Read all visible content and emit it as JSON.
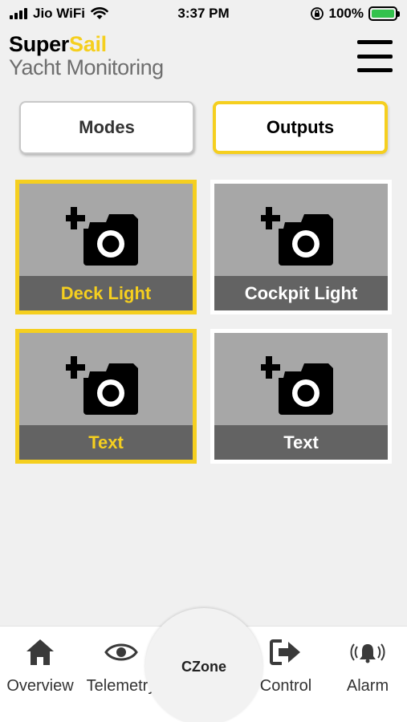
{
  "status_bar": {
    "carrier": "Jio WiFi",
    "time": "3:37 PM",
    "battery_percent": "100%",
    "icons": [
      "signal-icon",
      "wifi-icon",
      "orientation-lock-icon",
      "battery-charging-icon"
    ]
  },
  "header": {
    "brand_prefix": "Super",
    "brand_accent": "Sail",
    "subtitle": "Yacht Monitoring",
    "menu_icon": "hamburger-menu-icon"
  },
  "segment": {
    "modes_label": "Modes",
    "outputs_label": "Outputs",
    "selected": "Outputs"
  },
  "tiles": [
    {
      "label": "Deck Light",
      "icon": "add-photo-icon",
      "active": true
    },
    {
      "label": "Cockpit Light",
      "icon": "add-photo-icon",
      "active": false
    },
    {
      "label": "Text",
      "icon": "add-photo-icon",
      "active": true
    },
    {
      "label": "Text",
      "icon": "add-photo-icon",
      "active": false
    }
  ],
  "nav": {
    "items": [
      {
        "label": "Overview",
        "icon": "home-icon"
      },
      {
        "label": "Telemetry",
        "icon": "eye-icon"
      },
      {
        "label": "CZone",
        "icon": ""
      },
      {
        "label": "Control",
        "icon": "exit-arrow-icon"
      },
      {
        "label": "Alarm",
        "icon": "alarm-bell-icon"
      }
    ]
  },
  "colors": {
    "accent": "#f5cf1f",
    "tile_bg": "#a7a7a7",
    "tile_label_bg": "#636363",
    "page_bg": "#f0f0f0"
  }
}
